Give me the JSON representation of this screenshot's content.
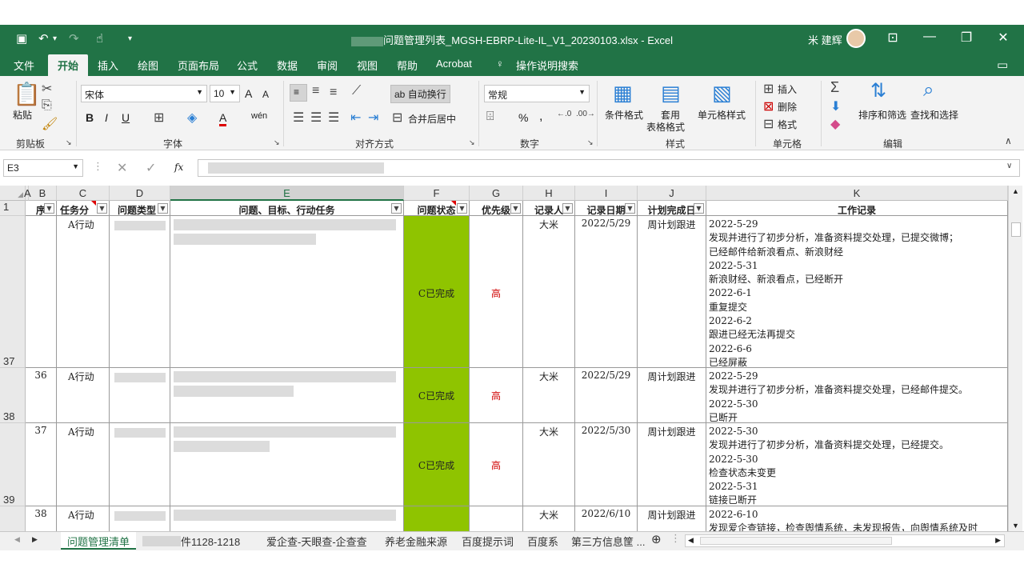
{
  "title_bar": {
    "filename": "问题管理列表_MGSH-EBRP-Lite-IL_V1_20230103.xlsx",
    "separator": "-",
    "app": "Excel",
    "user": "米 建辉"
  },
  "menu_tabs": [
    "文件",
    "开始",
    "插入",
    "绘图",
    "页面布局",
    "公式",
    "数据",
    "审阅",
    "视图",
    "帮助",
    "Acrobat",
    "操作说明搜索"
  ],
  "ribbon": {
    "clipboard": {
      "paste": "粘贴",
      "label": "剪贴板"
    },
    "font": {
      "name": "宋体",
      "size": "10",
      "label": "字体",
      "bold": "B",
      "italic": "I",
      "underline": "U",
      "grow": "A",
      "shrink": "A",
      "color_a": "A",
      "wen": "wén"
    },
    "alignment": {
      "wrap": "自动换行",
      "merge": "合并后居中",
      "label": "对齐方式"
    },
    "number": {
      "format": "常规",
      "label": "数字",
      "percent": "%",
      "comma": ","
    },
    "styles": {
      "cond": "条件格式",
      "table_1": "套用",
      "table_2": "表格格式",
      "cell": "单元格样式",
      "label": "样式"
    },
    "cells": {
      "insert": "插入",
      "delete": "删除",
      "format": "格式",
      "label": "单元格"
    },
    "editing": {
      "sort": "排序和筛选",
      "find": "查找和选择",
      "label": "编辑"
    }
  },
  "formula_bar": {
    "cell_ref": "E3",
    "fx": "fx"
  },
  "columns": [
    "A",
    "B",
    "C",
    "D",
    "E",
    "F",
    "G",
    "H",
    "I",
    "J",
    "K"
  ],
  "headers": {
    "b": "序",
    "c": "任务分",
    "d": "问题类型",
    "e": "问题、目标、行动任务",
    "f": "问题状态",
    "g": "优先级",
    "h": "记录人",
    "i": "记录日期",
    "j": "计划完成日",
    "k": "工作记录",
    "row": "1"
  },
  "rows": [
    {
      "row_num": "37",
      "seq": "",
      "task": "A行动",
      "status": "C已完成",
      "priority": "高",
      "recorder": "大米",
      "date": "2022/5/29",
      "plan": "周计划跟进",
      "log": [
        "2022-5-29",
        "发现并进行了初步分析，准备资料提交处理，已提交微博；",
        "已经邮件给新浪看点、新浪财经",
        "2022-5-31",
        "新浪财经、新浪看点，已经断开",
        "2022-6-1",
        "重复提交",
        "2022-6-2",
        "跟进已经无法再提交",
        "2022-6-6",
        "已经屏蔽"
      ]
    },
    {
      "row_num": "38",
      "seq": "36",
      "task": "A行动",
      "status": "C已完成",
      "priority": "高",
      "recorder": "大米",
      "date": "2022/5/29",
      "plan": "周计划跟进",
      "log": [
        "2022-5-29",
        "发现并进行了初步分析，准备资料提交处理，已经邮件提交。",
        "2022-5-30",
        "已断开"
      ]
    },
    {
      "row_num": "39",
      "seq": "37",
      "task": "A行动",
      "status": "C已完成",
      "priority": "高",
      "recorder": "大米",
      "date": "2022/5/30",
      "plan": "周计划跟进",
      "log": [
        "2022-5-30",
        "发现并进行了初步分析，准备资料提交处理，已经提交。",
        "2022-5-30",
        "检查状态未变更",
        "2022-5-31",
        "链接已断开"
      ]
    },
    {
      "row_num": "",
      "seq": "38",
      "task": "A行动",
      "status": "",
      "priority": "",
      "recorder": "大米",
      "date": "2022/6/10",
      "plan": "周计划跟进",
      "log": [
        "2022-6-10",
        "发现爱企查链接，检查舆情系统，未发现报告，向舆情系统及时"
      ]
    }
  ],
  "sheet_tabs": [
    "问题管理清单",
    "件1128-1218",
    "爱企查-天眼查-企查查",
    "养老金融来源",
    "百度提示词",
    "百度系",
    "第三方信息筐 ..."
  ],
  "colors": {
    "excel_green": "#217346",
    "done_fill": "#8fc400",
    "priority_red": "#d00000"
  }
}
